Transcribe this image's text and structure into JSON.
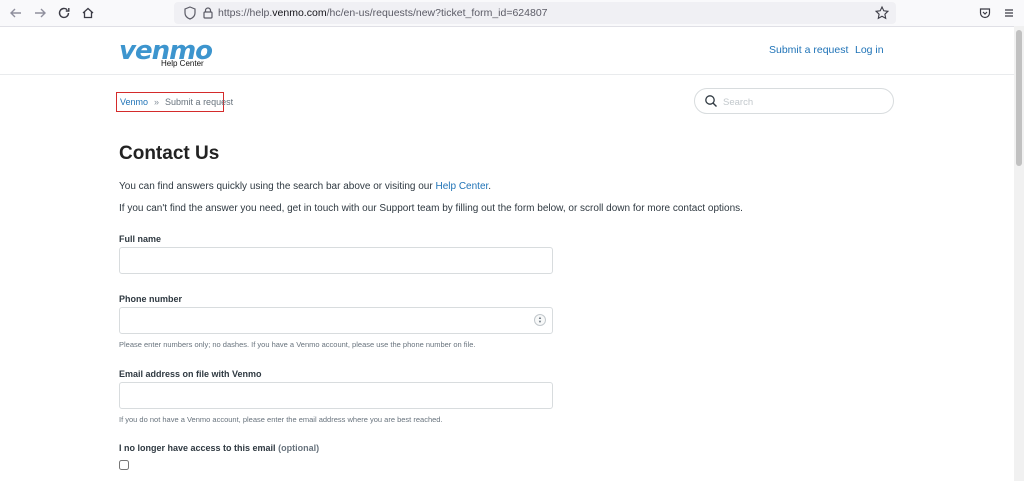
{
  "browser": {
    "url_prefix": "https://help.",
    "url_domain": "venmo.com",
    "url_rest": "/hc/en-us/requests/new?ticket_form_id=624807",
    "icons": [
      "back-icon",
      "forward-icon",
      "reload-icon",
      "home-icon",
      "shield-icon",
      "lock-icon",
      "star-icon",
      "pocket-icon",
      "menu-icon"
    ]
  },
  "header": {
    "logo_word": "venmo",
    "logo_sub": "Help Center",
    "submit_link": "Submit a request",
    "login_link": "Log in",
    "brand_color": "#3d95ce"
  },
  "breadcrumb": {
    "home": "Venmo",
    "separator": "»",
    "current": "Submit a request",
    "highlight_color": "#d42b2b"
  },
  "search": {
    "placeholder": "Search"
  },
  "main": {
    "title": "Contact Us",
    "intro1_text": "You can find answers quickly using the search bar above or visiting our ",
    "intro1_link": "Help Center",
    "intro1_end": ".",
    "intro2": "If you can't find the answer you need, get in touch with our Support team by filling out the form below, or scroll down for more contact options."
  },
  "form": {
    "full_name": {
      "label": "Full name",
      "value": ""
    },
    "phone": {
      "label": "Phone number",
      "value": "",
      "hint": "Please enter numbers only; no dashes. If you have a Venmo account, please use the phone number on file."
    },
    "email": {
      "label": "Email address on file with Venmo",
      "value": "",
      "hint": "If you do not have a Venmo account, please enter the email address where you are best reached."
    },
    "no_access": {
      "label": "I no longer have access to this email",
      "optional": "(optional)",
      "checked": false
    }
  }
}
